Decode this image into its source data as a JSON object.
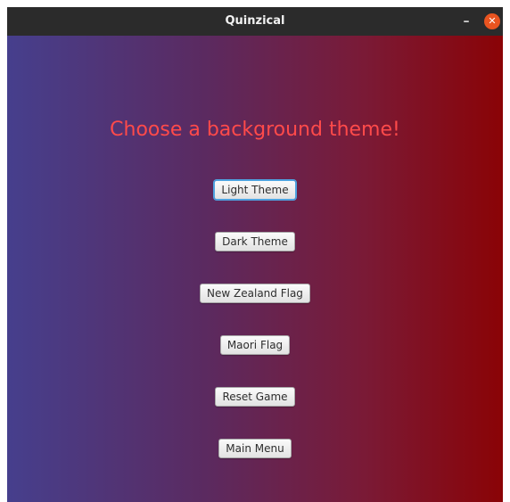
{
  "window": {
    "title": "Quinzical",
    "minimize_glyph": "–",
    "close_glyph": "✕"
  },
  "screen": {
    "heading": "Choose a background theme!",
    "buttons": [
      {
        "label": "Light Theme",
        "focused": true
      },
      {
        "label": "Dark Theme"
      },
      {
        "label": "New Zealand Flag"
      },
      {
        "label": "Maori Flag"
      },
      {
        "label": "Reset Game"
      },
      {
        "label": "Main Menu"
      }
    ]
  },
  "colors": {
    "gradient_left": "#463f8d",
    "gradient_right": "#8a0306",
    "heading": "#ff4a4a",
    "focus_ring": "#4fa3e0",
    "close_button": "#e95420"
  },
  "icons": {
    "minimize": "minimize-icon",
    "close": "close-icon"
  }
}
